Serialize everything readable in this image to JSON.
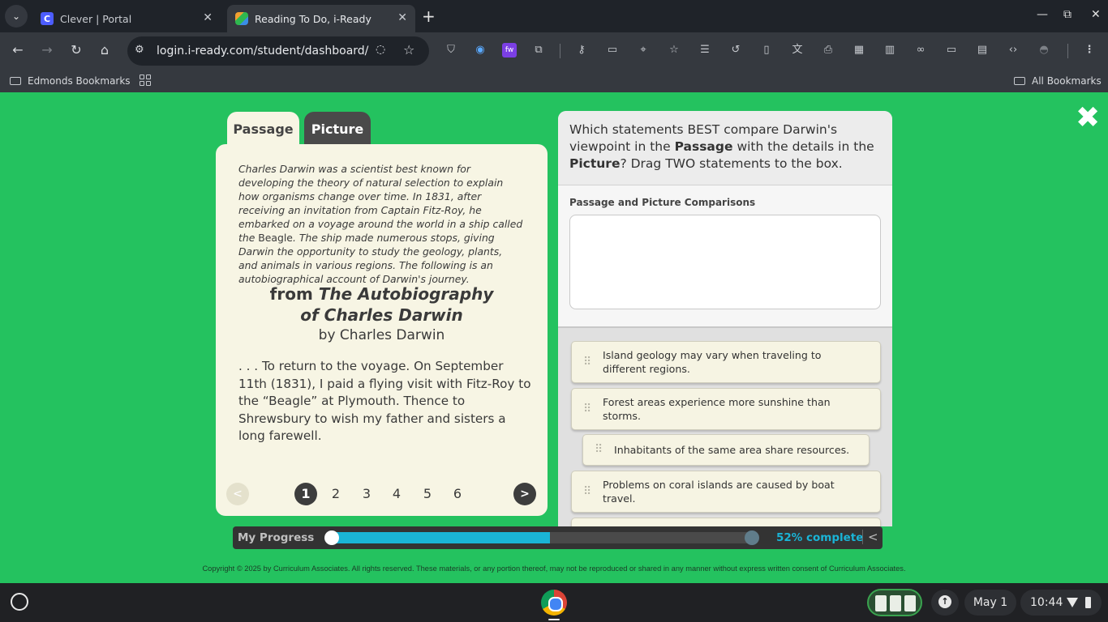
{
  "browser": {
    "tabs": [
      {
        "title": "Clever | Portal",
        "favicon_letter": "C"
      },
      {
        "title": "Reading To Do, i-Ready",
        "favicon_letter": ""
      }
    ],
    "new_tab_symbol": "+",
    "url": "login.i-ready.com/student/dashboard/h...",
    "window_controls": {
      "minimize": "—",
      "maximize": "⧉",
      "close": "✕"
    },
    "nav": {
      "back": "←",
      "forward": "→",
      "reload": "↻",
      "home": "⌂"
    },
    "toolbar_icons": [
      "shield-icon",
      "vpn-icon",
      "extension-fw-icon",
      "puzzle-icon",
      "key-icon",
      "card-icon",
      "location-icon",
      "star-outline-icon",
      "reader-icon",
      "history-icon",
      "trash-icon",
      "translate-icon",
      "print-icon",
      "qr-icon",
      "reading-mode-icon",
      "link-icon",
      "devices-icon",
      "layout-icon",
      "code-icon",
      "incognito-icon",
      "menu-icon"
    ],
    "bookmarks": {
      "left": "Edmonds Bookmarks",
      "right": "All Bookmarks"
    }
  },
  "page": {
    "tabs": {
      "passage": "Passage",
      "picture": "Picture"
    },
    "close_symbol": "✖",
    "intro_part1": "Charles Darwin was a scientist best known for developing the theory of natural selection to explain how organisms change over time. In 1831, after receiving an invitation from Captain Fitz-Roy, he embarked on a voyage around the world in a ship called the ",
    "intro_ship": "Beagle",
    "intro_part2": ". The ship made numerous stops, giving Darwin the opportunity to study the geology, plants, and animals in various regions. The following is an autobiographical account of Darwin's journey.",
    "title_prefix": "from ",
    "title_line1": "The Autobiography",
    "title_line2": "of Charles Darwin",
    "byline": "by Charles Darwin",
    "excerpt": ". . . To return to the voyage. On September 11th (1831), I paid a flying visit with Fitz-Roy to the “Beagle” at Plymouth. Thence to Shrewsbury to wish my father and sisters a long farewell.",
    "pager": {
      "prev": "<",
      "next": ">",
      "pages": [
        "1",
        "2",
        "3",
        "4",
        "5",
        "6"
      ],
      "current": "1"
    }
  },
  "question": {
    "text_1": "Which statements BEST compare Darwin's viewpoint in the ",
    "bold_1": "Passage",
    "text_2": " with the details in the ",
    "bold_2": "Picture",
    "text_3": "? Drag TWO statements to the box.",
    "dropzone_label": "Passage and Picture Comparisons",
    "statements": [
      "Island geology may vary when traveling to different regions.",
      "Forest areas experience more sunshine than storms.",
      "Inhabitants of the same area share resources.",
      "Problems on coral islands are caused by boat travel."
    ]
  },
  "progress": {
    "label": "My Progress",
    "percent": 52,
    "percent_text": "52% complete",
    "collapse_symbol": "<"
  },
  "copyright": "Copyright © 2025 by Curriculum Associates. All rights reserved. These materials, or any portion thereof, may not be reproduced or shared in any manner without express written consent of Curriculum Associates.",
  "shelf": {
    "date": "May 1",
    "time": "10:44"
  }
}
